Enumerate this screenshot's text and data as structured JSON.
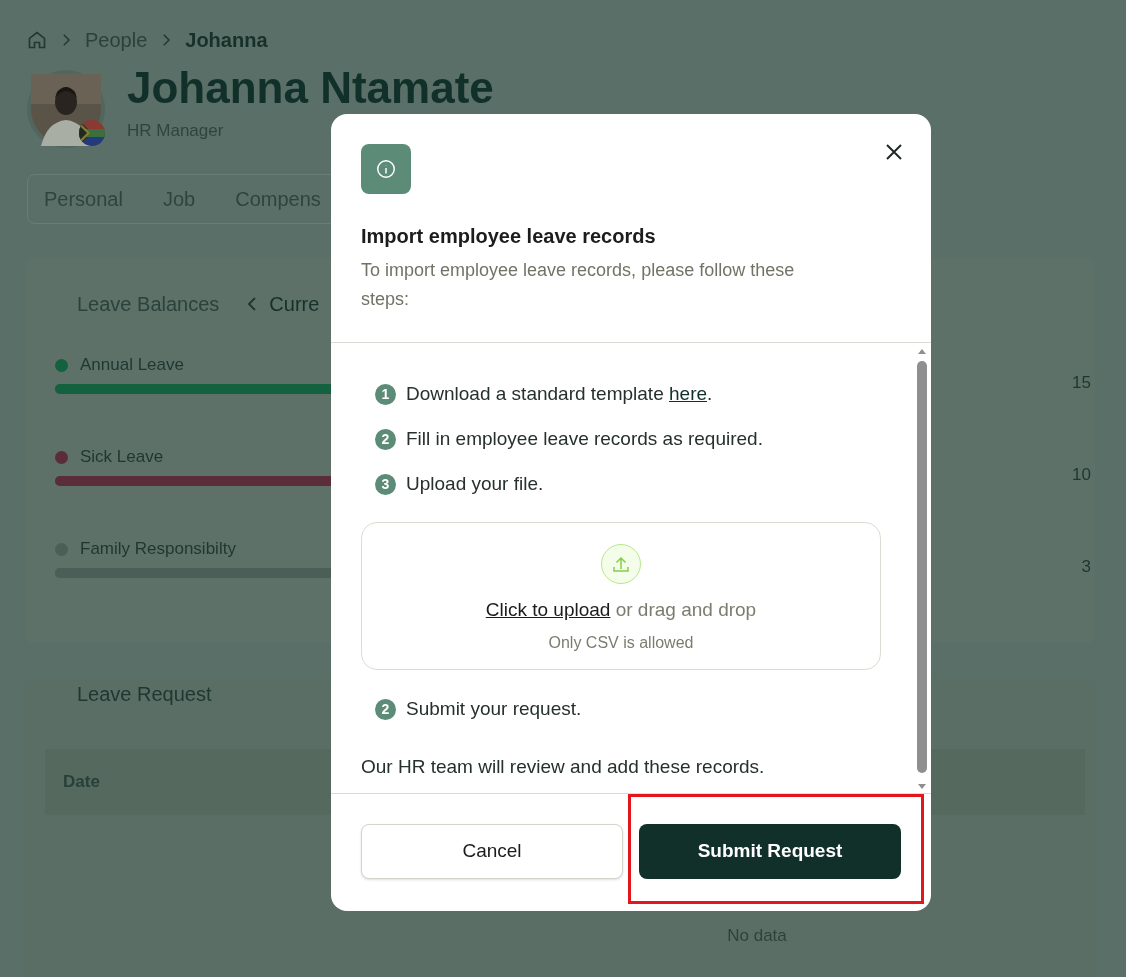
{
  "breadcrumb": [
    {
      "label": "People",
      "current": false
    },
    {
      "label": "Johanna",
      "current": true
    }
  ],
  "profile": {
    "name": "Johanna Ntamate",
    "role": "HR Manager"
  },
  "tabs": [
    {
      "label": "Personal",
      "selected": false
    },
    {
      "label": "Job",
      "selected": false
    },
    {
      "label": "Compens",
      "selected": false
    }
  ],
  "leave_balances": {
    "title": "Leave Balances",
    "period": "Curre",
    "items": [
      {
        "name": "Annual Leave",
        "color": "#13613f",
        "level": 1,
        "value": "15"
      },
      {
        "name": "Sick Leave",
        "color": "#5b2d3a",
        "level": 1,
        "value": "10"
      },
      {
        "name": "Family Responsibilty",
        "color": "#4b5f58",
        "level": 1,
        "value": "3"
      }
    ]
  },
  "leave_request": {
    "title": "Leave Request",
    "columns": [
      "Date"
    ],
    "empty_text": "No data"
  },
  "dialog": {
    "title": "Import employee leave records",
    "description": "To import employee leave records, please follow these steps:",
    "steps": [
      {
        "kind": "step",
        "number": "1",
        "text": "Download a standard template ",
        "link": "here",
        "after": "."
      },
      {
        "kind": "step",
        "number": "2",
        "text": "Fill in employee leave records as required."
      },
      {
        "kind": "step",
        "number": "3",
        "text": "Upload your file."
      },
      {
        "kind": "upload",
        "link": "Click to upload",
        "text": " or drag and drop",
        "hint": "Only CSV is allowed"
      },
      {
        "kind": "step",
        "number": "2",
        "text": "Submit your request."
      },
      {
        "kind": "note",
        "text": "Our HR team will review and add these records."
      }
    ],
    "cancel": "Cancel",
    "submit": "Submit Request",
    "submit_highlighted": true
  }
}
